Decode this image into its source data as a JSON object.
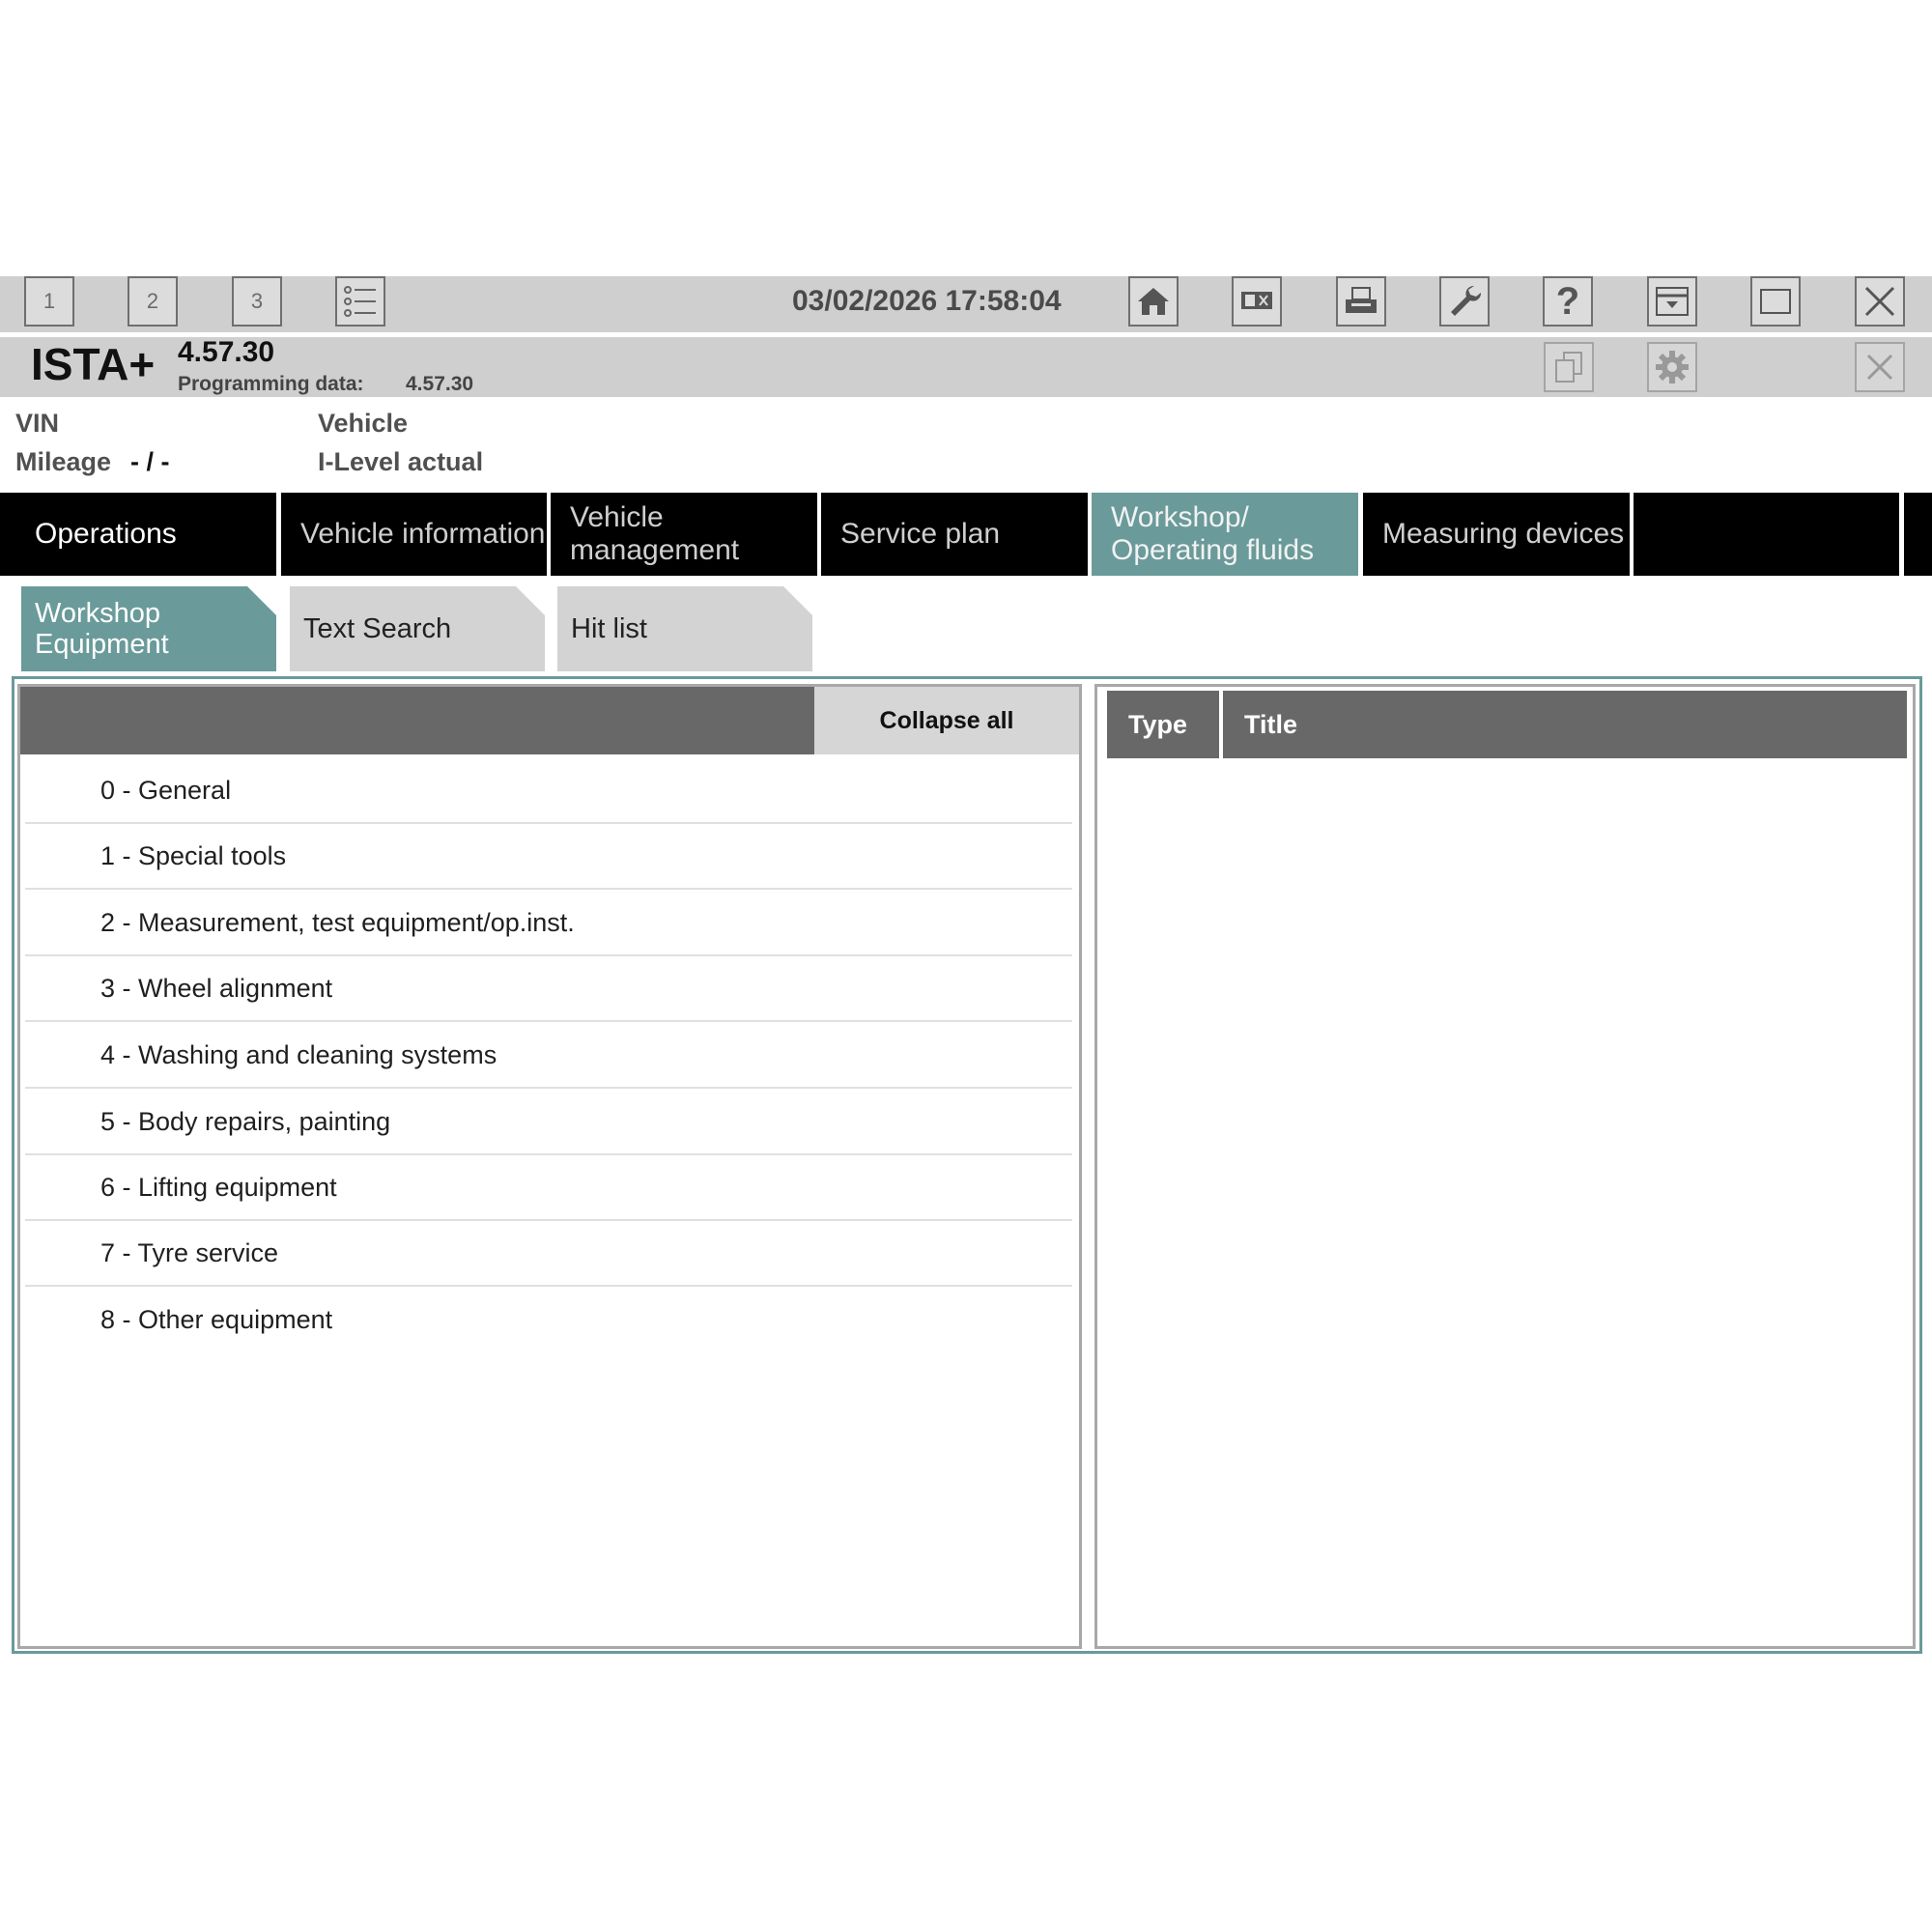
{
  "toolbar": {
    "session_buttons": [
      "1",
      "2",
      "3"
    ],
    "datetime": "03/02/2026 17:58:04",
    "icons": [
      "list-icon",
      "home-icon",
      "display-split-icon",
      "print-icon",
      "wrench-icon",
      "help-icon",
      "minimize-icon",
      "maximize-icon",
      "close-icon"
    ]
  },
  "header": {
    "app_title": "ISTA+",
    "version": "4.57.30",
    "programming_label": "Programming data:",
    "programming_value": "4.57.30",
    "icons": [
      "copy-documents-icon",
      "settings-gear-icon",
      "close-icon"
    ]
  },
  "vehicle": {
    "vin_label": "VIN",
    "mileage_label": "Mileage",
    "mileage_value": "- / -",
    "vehicle_label": "Vehicle",
    "ilevel_label": "I-Level actual"
  },
  "nav": {
    "tabs": [
      {
        "label": "Operations"
      },
      {
        "label": "Vehicle information"
      },
      {
        "label": "Vehicle management"
      },
      {
        "label": "Service plan"
      },
      {
        "label": "Workshop/ Operating fluids"
      },
      {
        "label": "Measuring devices"
      },
      {
        "label": ""
      }
    ],
    "active": "Workshop/ Operating fluids"
  },
  "subtabs": {
    "tabs": [
      {
        "label": "Workshop Equipment"
      },
      {
        "label": "Text Search"
      },
      {
        "label": "Hit list"
      }
    ],
    "active": "Workshop Equipment"
  },
  "left_panel": {
    "collapse_label": "Collapse all",
    "items": [
      {
        "label": "0 - General"
      },
      {
        "label": "1 - Special tools"
      },
      {
        "label": "2 - Measurement, test equipment/op.inst."
      },
      {
        "label": "3 - Wheel alignment"
      },
      {
        "label": "4 - Washing and cleaning systems"
      },
      {
        "label": "5 - Body repairs, painting"
      },
      {
        "label": "6 - Lifting equipment"
      },
      {
        "label": "7 - Tyre service"
      },
      {
        "label": "8 - Other equipment"
      }
    ]
  },
  "right_panel": {
    "columns": [
      "Type",
      "Title"
    ]
  },
  "colors": {
    "accent": "#6a9a9a",
    "nav_bg": "#000000",
    "toolbar_bg": "#cfcfcf",
    "table_header": "#686868"
  }
}
